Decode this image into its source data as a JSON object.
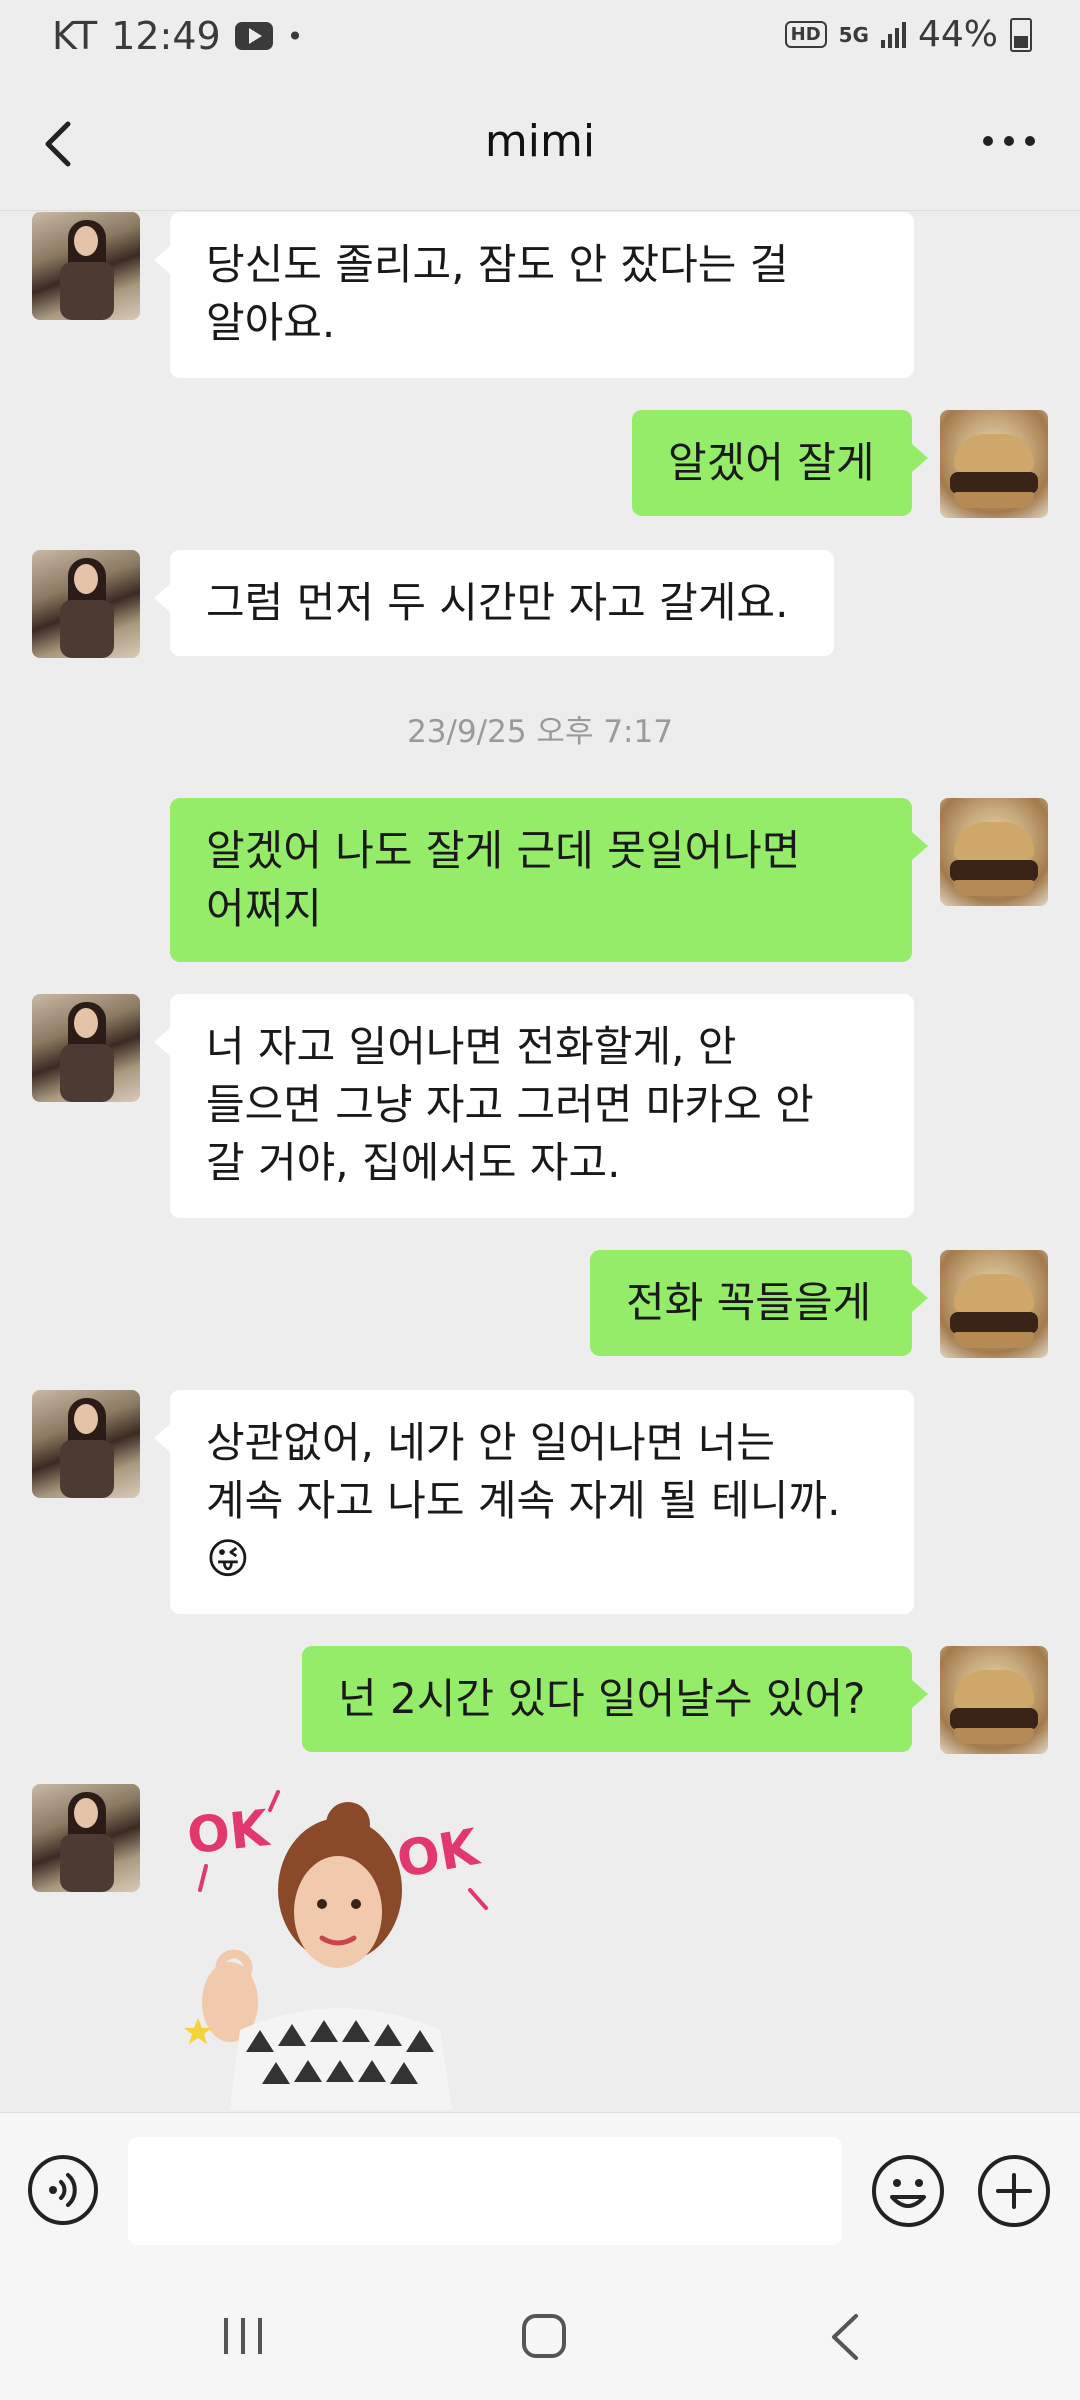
{
  "status_bar": {
    "carrier": "KT",
    "time": "12:49",
    "left_icons": [
      "youtube-icon",
      "notification-icon"
    ],
    "hd_badge": "HD",
    "network": "5G",
    "signal_icon": "signal-icon",
    "battery_percent": "44%",
    "battery_level": 0.44
  },
  "header": {
    "title": "mimi",
    "back_icon": "back-arrow-icon",
    "more_icon": "more-icon"
  },
  "messages": [
    {
      "sender": "mimi",
      "lines": [
        "당신도 졸리고, 잠도 안 잤다는 걸",
        "알아요."
      ]
    },
    {
      "sender": "me",
      "lines": [
        "알겠어 잘게"
      ]
    },
    {
      "sender": "mimi",
      "lines": [
        "그럼 먼저 두 시간만 자고 갈게요."
      ]
    },
    {
      "sender": "me",
      "lines": [
        "알겠어 나도 잘게 근데 못일어나면",
        "어쩌지"
      ]
    },
    {
      "sender": "mimi",
      "lines": [
        "너 자고 일어나면 전화할게, 안",
        "들으면 그냥 자고 그러면 마카오 안",
        "갈 거야, 집에서도 자고."
      ]
    },
    {
      "sender": "me",
      "lines": [
        "전화 꼭들을게"
      ]
    },
    {
      "sender": "mimi",
      "lines": [
        "상관없어, 네가 안 일어나면 너는",
        "계속 자고 나도 계속 자게 될 테니까."
      ],
      "emoji": "😜"
    },
    {
      "sender": "me",
      "lines": [
        "넌 2시간 있다 일어날수 있어?"
      ]
    }
  ],
  "timestamp": "23/9/25 오후 7:17",
  "sticker": {
    "text_left": "OK",
    "text_right": "OK"
  },
  "input_bar": {
    "voice_icon": "voice-icon",
    "input_value": "",
    "emoji_icon": "emoji-icon",
    "plus_icon": "plus-icon"
  },
  "nav_bar": {
    "recent_icon": "recent-apps-icon",
    "home_icon": "home-icon",
    "back_icon": "nav-back-icon"
  },
  "colors": {
    "background": "#ededed",
    "incoming_bubble": "#ffffff",
    "outgoing_bubble": "#95ec69",
    "text": "#191919",
    "timestamp": "#9a9a9a"
  }
}
